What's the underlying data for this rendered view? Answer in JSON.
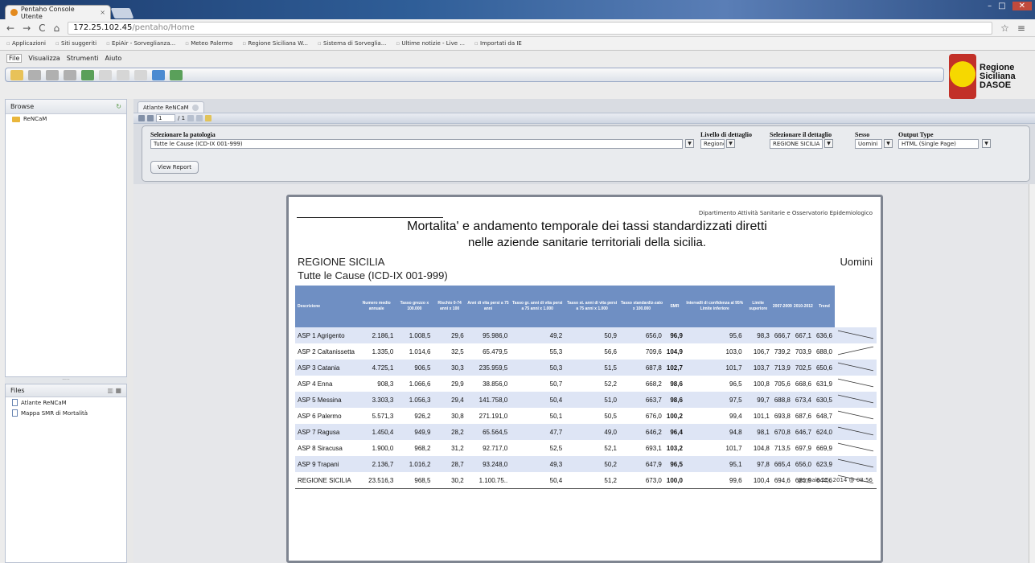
{
  "browser": {
    "tab_title": "Pentaho Console Utente",
    "tab_close": "×",
    "url_host": "172.25.102.45",
    "url_path": "/pentaho/Home",
    "bookmarks": [
      "Applicazioni",
      "Siti suggeriti",
      "EpiAir - Sorveglianza...",
      "Meteo Palermo",
      "Regione Siciliana W...",
      "Sistema di Sorveglia...",
      "Ultime notizie - Live ...",
      "Importati da IE"
    ]
  },
  "menu": [
    "File",
    "Visualizza",
    "Strumenti",
    "Aiuto"
  ],
  "logo": {
    "line1": "Regione",
    "line2": "Siciliana",
    "line3": "DASOE"
  },
  "browse": {
    "title": "Browse",
    "items": [
      "ReNCaM"
    ]
  },
  "files": {
    "title": "Files",
    "items": [
      "Atlante ReNCaM",
      "Mappa SMR di Mortalità"
    ]
  },
  "doc_tab": "Atlante ReNCaM",
  "pager": {
    "page": "1",
    "total": "/ 1"
  },
  "params": {
    "patologia_label": "Selezionare la patologia",
    "patologia_value": "Tutte le Cause (ICD-IX 001-999)",
    "livello_label": "Livello di dettaglio",
    "livello_value": "Regione",
    "dettaglio_label": "Selezionare il dettaglio",
    "dettaglio_value": "REGIONE SICILIA",
    "sesso_label": "Sesso",
    "sesso_value": "Uomini",
    "output_label": "Output Type",
    "output_value": "HTML (Single Page)",
    "view_report": "View Report"
  },
  "report": {
    "dept": "Dipartimento Attività Sanitarie e Osservatorio Epidemiologico",
    "title1": "Mortalita' e andamento temporale dei tassi standardizzati diretti",
    "title2": "nelle aziende sanitarie territoriali della sicilia.",
    "region": "REGIONE SICILIA",
    "sex": "Uomini",
    "cause": "Tutte le Cause (ICD-IX 001-999)",
    "date": "gennaio 15, 2014 @ 08:56",
    "headers": [
      "Descrizione",
      "Numero medio annuale",
      "Tasso grezzo x 100.000",
      "Rischio 0-74 anni x 100",
      "Anni di vita persi a 75 anni",
      "Tasso gr. anni di vita persi a 75 anni x 1.000",
      "Tasso st. anni di vita persi a 75 anni x 1.000",
      "Tasso standardiz-zato x 100.000",
      "SMR",
      "Intervalli di confidenza al 95% Limite inferiore",
      "Limite superiore",
      "2007-2009",
      "2010-2012",
      "Trend"
    ],
    "rows": [
      {
        "d": "ASP 1 Agrigento",
        "c": [
          "2.186,1",
          "1.008,5",
          "29,6",
          "95.986,0",
          "49,2",
          "50,9",
          "656,0",
          "96,9",
          "95,6",
          "98,3",
          "666,7",
          "667,1",
          "636,6"
        ],
        "trend": [
          0.15,
          0.85
        ]
      },
      {
        "d": "ASP 2 Caltanissetta",
        "c": [
          "1.335,0",
          "1.014,6",
          "32,5",
          "65.479,5",
          "55,3",
          "56,6",
          "709,6",
          "104,9",
          "103,0",
          "106,7",
          "739,2",
          "703,9",
          "688,0"
        ],
        "trend": [
          0.85,
          0.15
        ]
      },
      {
        "d": "ASP 3 Catania",
        "c": [
          "4.725,1",
          "906,5",
          "30,3",
          "235.959,5",
          "50,3",
          "51,5",
          "687,8",
          "102,7",
          "101,7",
          "103,7",
          "713,9",
          "702,5",
          "650,6"
        ],
        "trend": [
          0.15,
          0.85
        ]
      },
      {
        "d": "ASP 4 Enna",
        "c": [
          "908,3",
          "1.066,6",
          "29,9",
          "38.856,0",
          "50,7",
          "52,2",
          "668,2",
          "98,6",
          "96,5",
          "100,8",
          "705,6",
          "668,6",
          "631,9"
        ],
        "trend": [
          0.15,
          0.85
        ]
      },
      {
        "d": "ASP 5 Messina",
        "c": [
          "3.303,3",
          "1.056,3",
          "29,4",
          "141.758,0",
          "50,4",
          "51,0",
          "663,7",
          "98,6",
          "97,5",
          "99,7",
          "688,8",
          "673,4",
          "630,5"
        ],
        "trend": [
          0.15,
          0.85
        ]
      },
      {
        "d": "ASP 6 Palermo",
        "c": [
          "5.571,3",
          "926,2",
          "30,8",
          "271.191,0",
          "50,1",
          "50,5",
          "676,0",
          "100,2",
          "99,4",
          "101,1",
          "693,8",
          "687,6",
          "648,7"
        ],
        "trend": [
          0.15,
          0.85
        ]
      },
      {
        "d": "ASP 7 Ragusa",
        "c": [
          "1.450,4",
          "949,9",
          "28,2",
          "65.564,5",
          "47,7",
          "49,0",
          "646,2",
          "96,4",
          "94,8",
          "98,1",
          "670,8",
          "646,7",
          "624,0"
        ],
        "trend": [
          0.15,
          0.85
        ]
      },
      {
        "d": "ASP 8 Siracusa",
        "c": [
          "1.900,0",
          "968,2",
          "31,2",
          "92.717,0",
          "52,5",
          "52,1",
          "693,1",
          "103,2",
          "101,7",
          "104,8",
          "713,5",
          "697,9",
          "669,9"
        ],
        "trend": [
          0.15,
          0.85
        ]
      },
      {
        "d": "ASP 9 Trapani",
        "c": [
          "2.136,7",
          "1.016,2",
          "28,7",
          "93.248,0",
          "49,3",
          "50,2",
          "647,9",
          "96,5",
          "95,1",
          "97,8",
          "665,4",
          "656,0",
          "623,9"
        ],
        "trend": [
          0.15,
          0.85
        ]
      },
      {
        "d": "REGIONE SICILIA",
        "c": [
          "23.516,3",
          "968,5",
          "30,2",
          "1.100.75..",
          "50,4",
          "51,2",
          "673,0",
          "100,0",
          "99,6",
          "100,4",
          "694,6",
          "681,9",
          "644,6"
        ],
        "trend": [
          0.15,
          0.85
        ]
      }
    ]
  }
}
